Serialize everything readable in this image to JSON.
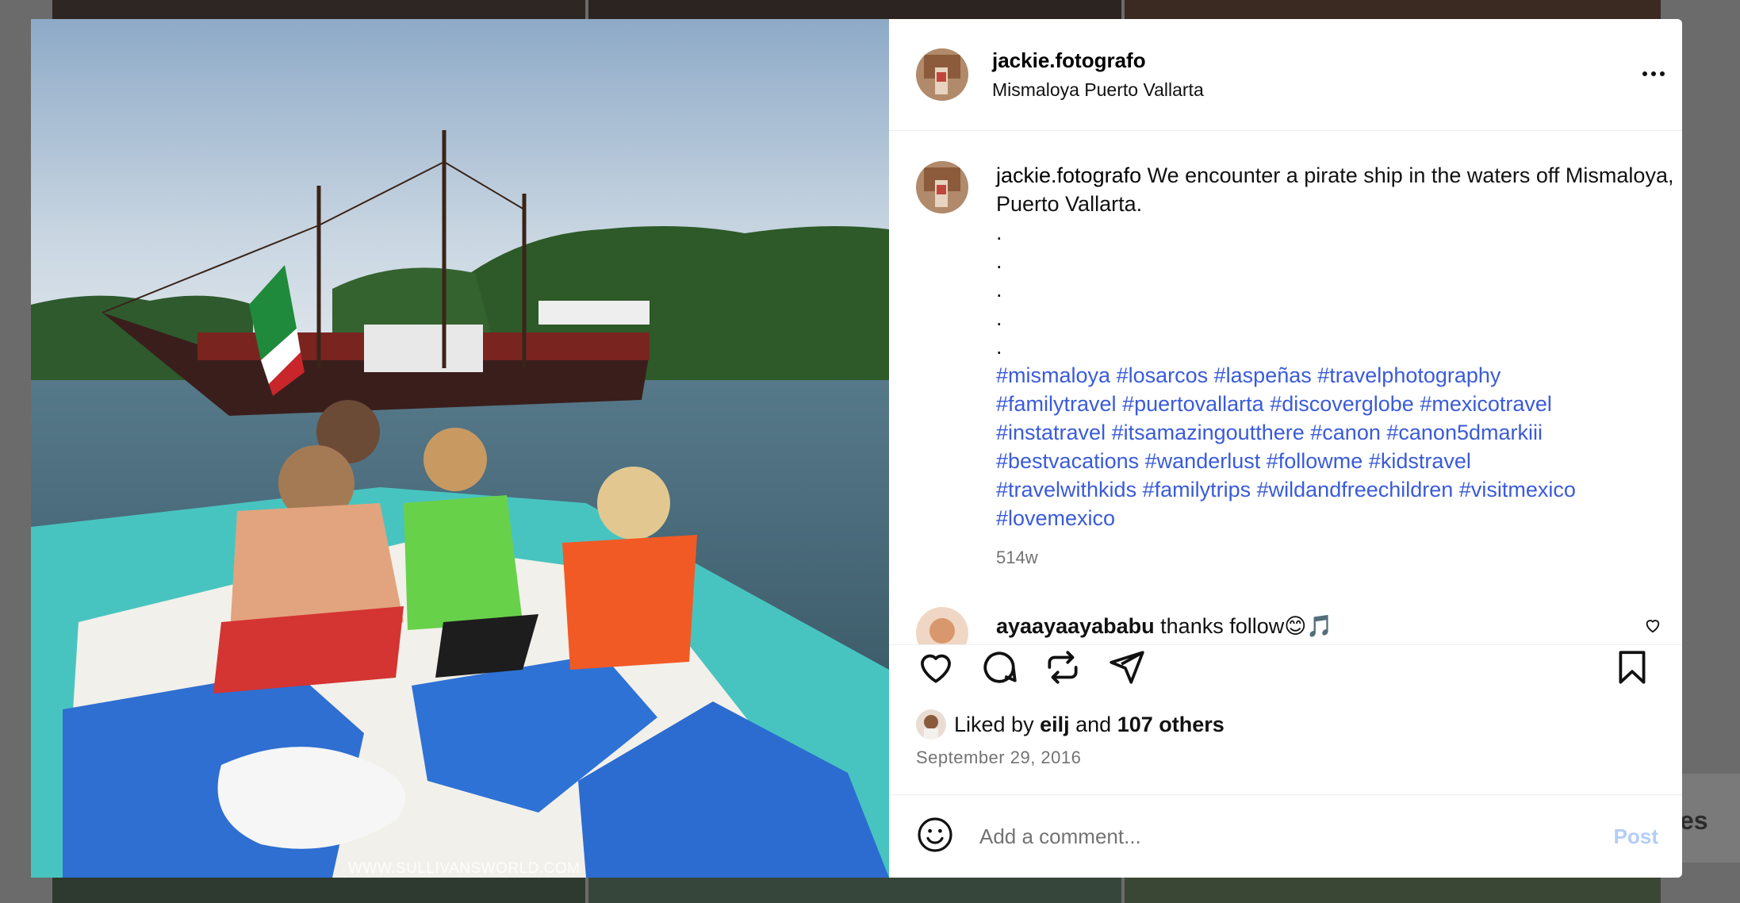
{
  "post": {
    "username": "jackie.fotografo",
    "location": "Mismaloya Puerto Vallarta",
    "caption_user": "jackie.fotografo",
    "caption_text": "We encounter a pirate ship in the waters off Mismaloya, Puerto Vallarta.",
    "dots": [
      ".",
      ".",
      ".",
      ".",
      "."
    ],
    "hashtags": [
      "#mismaloya",
      "#losarcos",
      "#laspeñas",
      "#travelphotography",
      "#familytravel",
      "#puertovallarta",
      "#discoverglobe",
      "#mexicotravel",
      "#instatravel",
      "#itsamazingoutthere",
      "#canon",
      "#canon5dmarkiii",
      "#bestvacations",
      "#wanderlust",
      "#followme",
      "#kidstravel",
      "#travelwithkids",
      "#familytrips",
      "#wildandfreechildren",
      "#visitmexico",
      "#lovemexico"
    ],
    "age": "514w",
    "watermark": "WWW.SULLIVANSWORLD.COM"
  },
  "reply": {
    "username": "ayaayaayababu",
    "text": "thanks follow😊🎵"
  },
  "likes": {
    "prefix": "Liked by",
    "user": "eilj",
    "and": "and",
    "others": "107 others"
  },
  "date": "September 29, 2016",
  "comment_box": {
    "placeholder": "Add a comment...",
    "post_label": "Post"
  },
  "background": {
    "side_text": "es"
  },
  "icons": {
    "like": "heart-icon",
    "comment": "comment-icon",
    "repost": "repost-icon",
    "share": "send-icon",
    "save": "bookmark-icon",
    "emoji": "emoji-icon",
    "more": "more-options-icon"
  },
  "colors": {
    "hashtag": "#3a5bd9",
    "post_disabled": "#b3cdf6",
    "muted_text": "#737373"
  }
}
